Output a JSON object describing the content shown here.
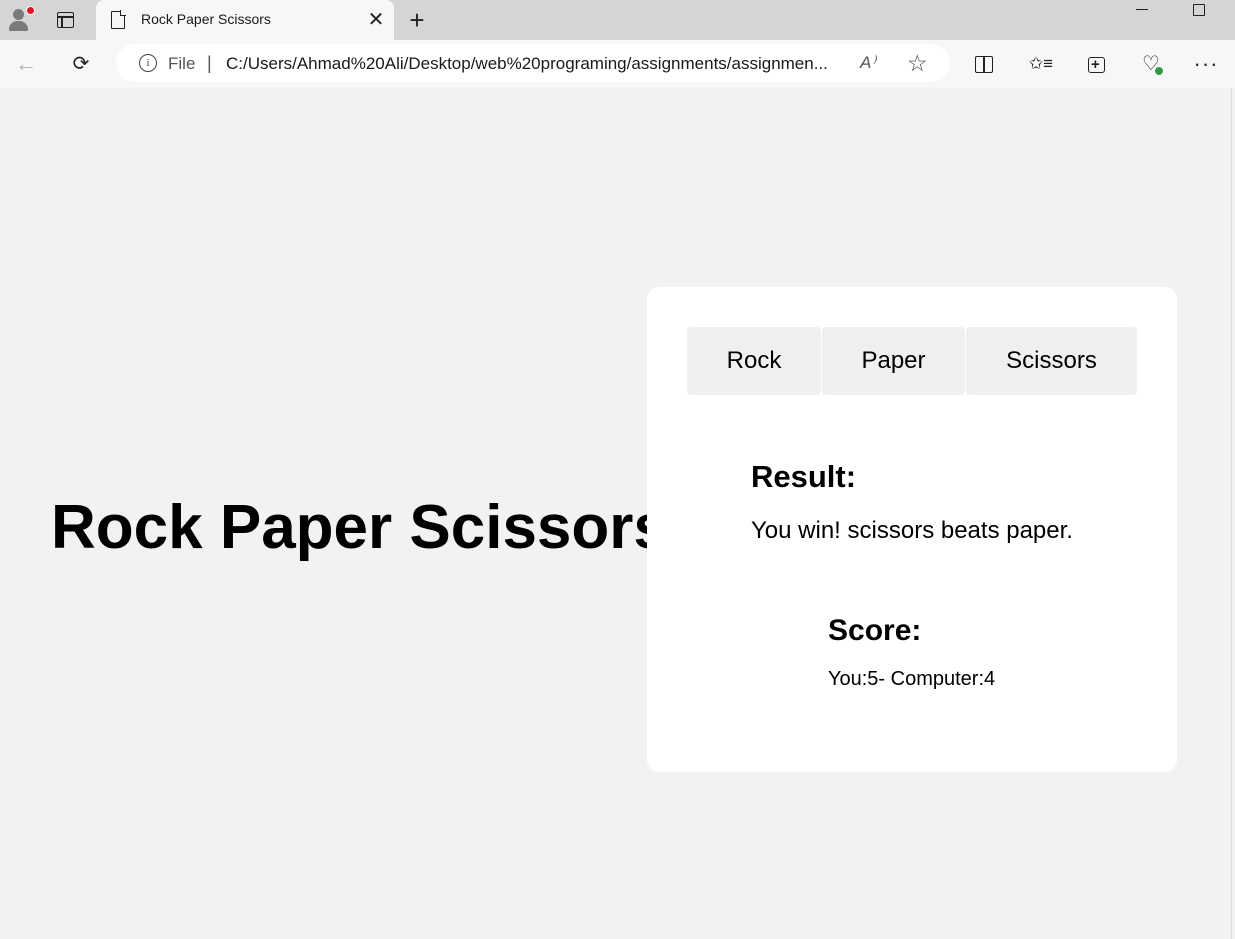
{
  "browser": {
    "tab": {
      "title": "Rock Paper Scissors",
      "icon": "page-icon",
      "close": "✕"
    },
    "new_tab": "+",
    "address": {
      "scheme": "File",
      "separator": "|",
      "url": "C:/Users/Ahmad%20Ali/Desktop/web%20programing/assignments/assignmen..."
    },
    "icons": {
      "back": "←",
      "reload": "⟳",
      "read_aloud": "A⁾",
      "favorite": "☆",
      "favorites": "✩≡",
      "more": "···"
    }
  },
  "page": {
    "heading": "Rock Paper Scissors",
    "buttons": {
      "rock": "Rock",
      "paper": "Paper",
      "scissors": "Scissors"
    },
    "result": {
      "label": "Result:",
      "text": "You win! scissors beats paper."
    },
    "score": {
      "label": "Score:",
      "text": "You:5- Computer:4"
    }
  }
}
